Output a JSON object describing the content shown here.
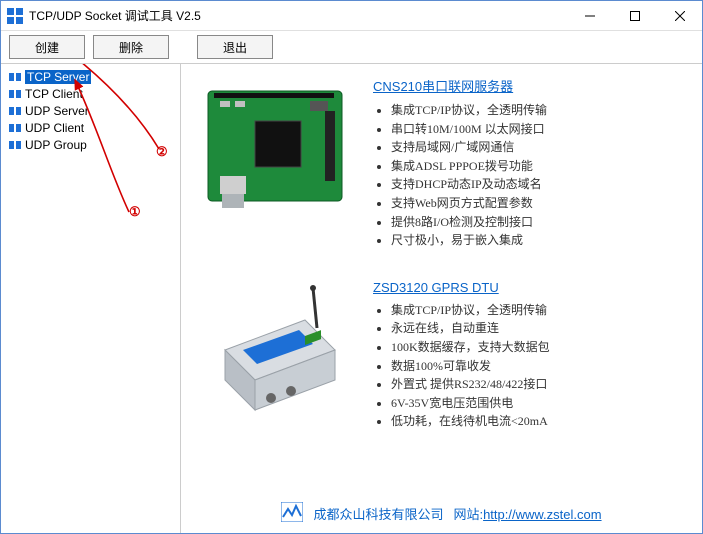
{
  "window": {
    "title": "TCP/UDP Socket 调试工具 V2.5"
  },
  "toolbar": {
    "create": "创建",
    "delete": "删除",
    "exit": "退出"
  },
  "sidebar": {
    "items": [
      {
        "label": "TCP Server",
        "selected": true
      },
      {
        "label": "TCP Client",
        "selected": false
      },
      {
        "label": "UDP Server",
        "selected": false
      },
      {
        "label": "UDP Client",
        "selected": false
      },
      {
        "label": "UDP Group",
        "selected": false
      }
    ]
  },
  "annotations": {
    "marker1": "①",
    "marker2": "②"
  },
  "products": [
    {
      "title": "CNS210串口联网服务器",
      "features": [
        "集成TCP/IP协议，全透明传输",
        "串口转10M/100M 以太网接口",
        "支持局域网/广域网通信",
        "集成ADSL PPPOE拨号功能",
        "支持DHCP动态IP及动态域名",
        "支持Web网页方式配置参数",
        "提供8路I/O检测及控制接口",
        "尺寸极小，易于嵌入集成"
      ]
    },
    {
      "title": "ZSD3120 GPRS DTU",
      "features": [
        "集成TCP/IP协议，全透明传输",
        "永远在线，自动重连",
        "100K数据缓存，支持大数据包",
        "数据100%可靠收发",
        "外置式 提供RS232/48/422接口",
        "6V-35V宽电压范围供电",
        "低功耗，在线待机电流<20mA"
      ]
    }
  ],
  "footer": {
    "company": "成都众山科技有限公司",
    "site_label": "网站:",
    "site_url": "http://www.zstel.com"
  }
}
